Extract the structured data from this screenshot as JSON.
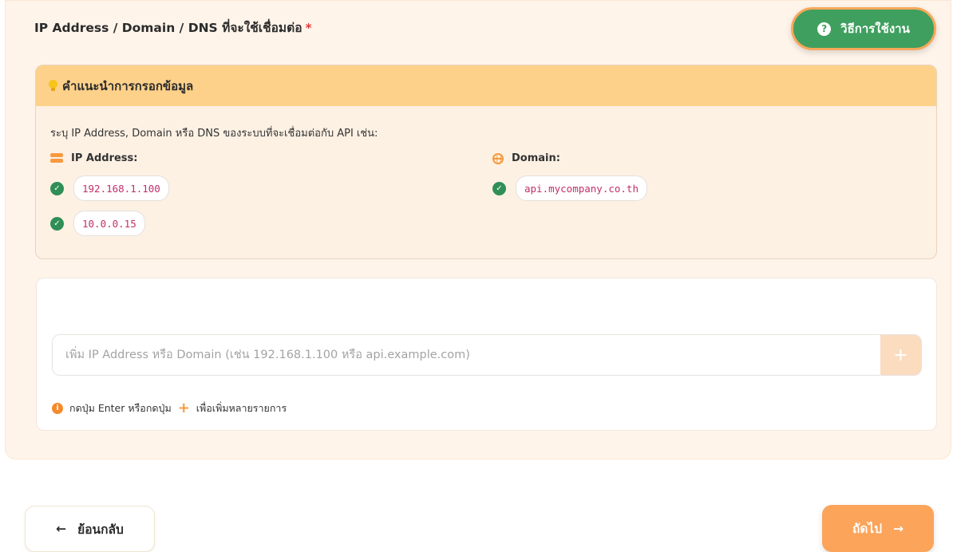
{
  "field": {
    "title": "IP Address / Domain / DNS ที่จะใช้เชื่อมต่อ",
    "required_mark": "*"
  },
  "howto_button": {
    "icon": "question-circle-icon",
    "label": "วิธีการใช้งาน"
  },
  "tip": {
    "header": "คำแนะนำการกรอกข้อมูล",
    "description": "ระบุ IP Address, Domain หรือ DNS ของระบบที่จะเชื่อมต่อกับ API เช่น:",
    "ip_column": {
      "icon": "server-icon",
      "label": "IP Address:",
      "examples": [
        "192.168.1.100",
        "10.0.0.15"
      ]
    },
    "domain_column": {
      "icon": "globe-icon",
      "label": "Domain:",
      "examples": [
        "api.mycompany.co.th"
      ]
    }
  },
  "input": {
    "placeholder": "เพิ่ม IP Address หรือ Domain (เช่น 192.168.1.100 หรือ api.example.com)",
    "value": "",
    "add_button": "+"
  },
  "hint": {
    "icon": "info-icon",
    "text_before": "กดปุ่ม Enter หรือกดปุ่ม",
    "plus": "+",
    "text_after": "เพื่อเพิ่มหลายรายการ"
  },
  "nav": {
    "back_arrow": "←",
    "back_label": "ย้อนกลับ",
    "next_label": "ถัดไป",
    "next_arrow": "→"
  },
  "colors": {
    "accent_orange": "#fba45a",
    "success_green": "#3f9f5f",
    "tip_header_bg": "#fdd18a",
    "chip_text": "#c22f6a"
  }
}
